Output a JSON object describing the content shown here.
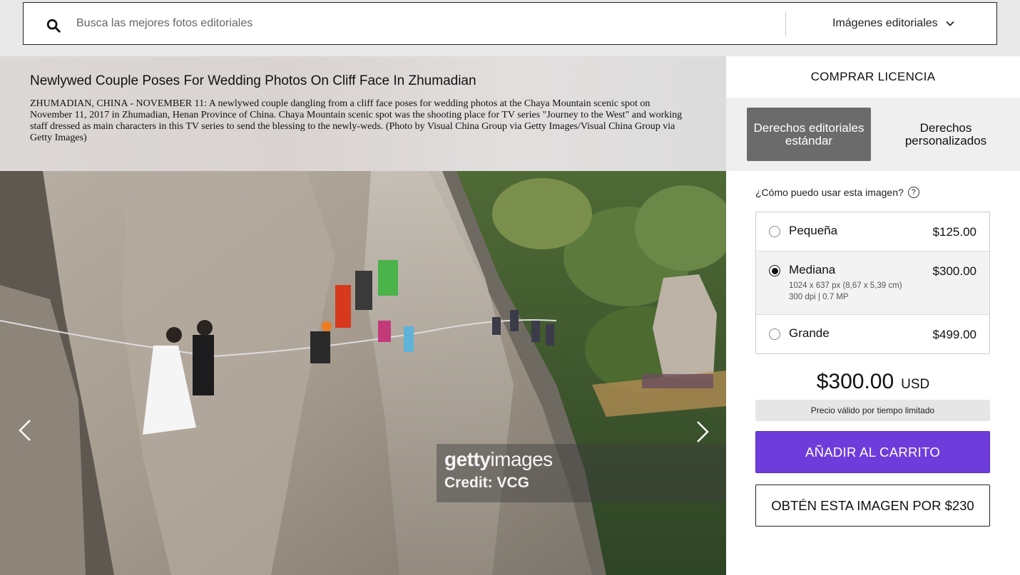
{
  "search": {
    "placeholder": "Busca las mejores fotos editoriales",
    "scope_label": "Imágenes editoriales",
    "icons": {
      "search": "search-icon",
      "dropdown": "chevron-down-icon"
    }
  },
  "image": {
    "title": "Newlywed Couple Poses For Wedding Photos On Cliff Face In Zhumadian",
    "description": "ZHUMADIAN, CHINA - NOVEMBER 11: A newlywed couple dangling from a cliff face poses for wedding photos at the Chaya Mountain scenic spot on November 11, 2017 in Zhumadian, Henan Province of China. Chaya Mountain scenic spot was the shooting place for TV series \"Journey to the West\" and working staff dressed as main characters in this TV series to send the blessing to the newly-weds. (Photo by Visual China Group via Getty Images/Visual China Group via Getty Images)",
    "watermark_brand_bold": "getty",
    "watermark_brand_light": "images",
    "watermark_credit": "Credit: VCG",
    "icons": {
      "prev": "chevron-left-icon",
      "next": "chevron-right-icon"
    }
  },
  "license": {
    "header": "COMPRAR LICENCIA",
    "tabs": [
      {
        "label": "Derechos editoriales estándar",
        "active": true
      },
      {
        "label": "Derechos personalizados",
        "active": false
      }
    ],
    "usage_question": "¿Cómo puedo usar esta imagen?",
    "help_glyph": "?",
    "sizes": [
      {
        "name": "Pequeña",
        "price": "$125.00",
        "selected": false
      },
      {
        "name": "Mediana",
        "price": "$300.00",
        "selected": true,
        "dimensions": "1024 x 637 px (8,67 x 5,39 cm)",
        "resolution": "300 dpi | 0.7 MP"
      },
      {
        "name": "Grande",
        "price": "$499.00",
        "selected": false
      }
    ],
    "total_amount": "$300.00",
    "currency": "USD",
    "validity_note": "Precio válido por tiempo limitado",
    "add_to_cart": "AÑADIR AL CARRITO",
    "get_image_offer": "OBTÉN ESTA IMAGEN POR $230",
    "colors": {
      "accent": "#6e3cdb",
      "active_tab": "#6b6b6b"
    }
  }
}
